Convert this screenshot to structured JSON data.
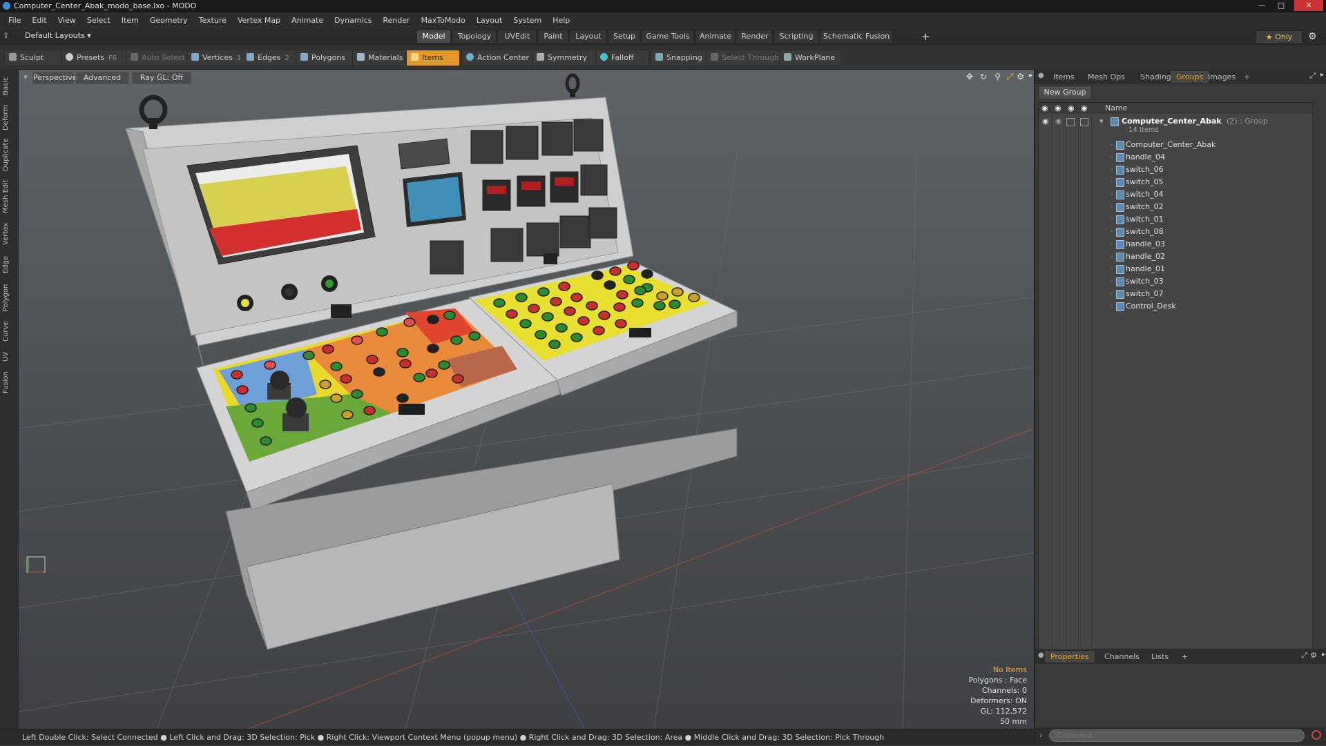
{
  "window": {
    "title": "Computer_Center_Abak_modo_base.lxo - MODO"
  },
  "menu": [
    "File",
    "Edit",
    "View",
    "Select",
    "Item",
    "Geometry",
    "Texture",
    "Vertex Map",
    "Animate",
    "Dynamics",
    "Render",
    "MaxToModo",
    "Layout",
    "System",
    "Help"
  ],
  "layouts": {
    "selector": "Default Layouts ▾",
    "tabs": [
      "Model",
      "Topology",
      "UVEdit",
      "Paint",
      "Layout",
      "Setup",
      "Game Tools",
      "Animate",
      "Render",
      "Scripting",
      "Schematic Fusion"
    ],
    "active": "Model",
    "add": "+",
    "only": "★ Only"
  },
  "toolbar": {
    "sculpt": "Sculpt",
    "presets": "Presets",
    "presets_key": "F6",
    "auto_select": "Auto Select",
    "vertices": "Vertices",
    "vertices_count": "1",
    "edges": "Edges",
    "edges_count": "2",
    "polygons": "Polygons",
    "materials": "Materials",
    "items": "Items",
    "action_center": "Action Center",
    "symmetry": "Symmetry",
    "falloff": "Falloff",
    "snapping": "Snapping",
    "select_through": "Select Through",
    "workplane": "WorkPlane"
  },
  "sidetabs": [
    "Basic",
    "Deform",
    "Duplicate",
    "Mesh Edit",
    "Vertex",
    "Edge",
    "Polygon",
    "Curve",
    "UV",
    "Fusion"
  ],
  "viewport": {
    "view": "Perspective",
    "shading": "Advanced",
    "raygl": "Ray GL: Off"
  },
  "hud": {
    "no_items": "No Items",
    "polygons": "Polygons : Face",
    "channels": "Channels: 0",
    "deformers": "Deformers: ON",
    "gl": "GL: 112,572",
    "scale": "50 mm"
  },
  "status": "Left Double Click: Select Connected ● Left Click and Drag: 3D Selection: Pick ● Right Click: Viewport Context Menu (popup menu) ● Right Click and Drag: 3D Selection: Area ● Middle Click and Drag: 3D Selection: Pick Through",
  "panel_top": {
    "tabs": [
      "Items",
      "Mesh Ops",
      "Shading",
      "Groups",
      "Images",
      "+"
    ],
    "active": "Groups",
    "new_group": "New Group",
    "name_header": "Name",
    "group_name": "Computer_Center_Abak",
    "group_suffix": "(2) : Group",
    "group_count": "14 Items",
    "items": [
      "Computer_Center_Abak",
      "handle_04",
      "switch_06",
      "switch_05",
      "switch_04",
      "switch_02",
      "switch_01",
      "switch_08",
      "handle_03",
      "handle_02",
      "handle_01",
      "switch_03",
      "switch_07",
      "Control_Desk"
    ]
  },
  "panel_bottom": {
    "tabs": [
      "Properties",
      "Channels",
      "Lists",
      "+"
    ],
    "active": "Properties",
    "command_placeholder": "Command"
  },
  "colors": {
    "accent": "#f0a62e",
    "active_tool": "#e49a2a",
    "desk": "#c9c9c9"
  }
}
